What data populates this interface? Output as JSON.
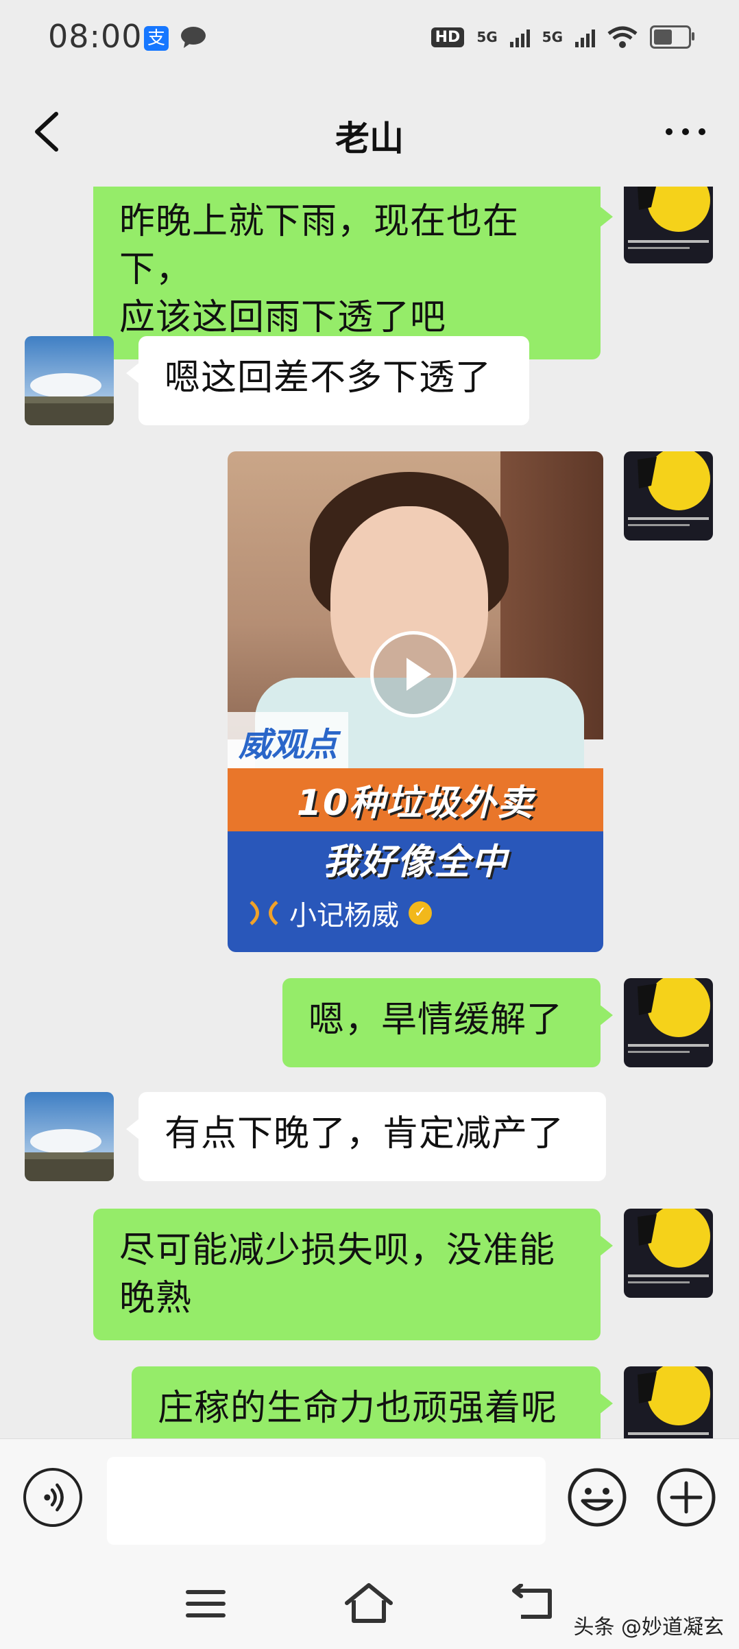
{
  "status_bar": {
    "time": "08:00",
    "alipay_glyph": "支",
    "network_1": "5G",
    "network_2": "5G",
    "hd_badge": "HD"
  },
  "header": {
    "title": "老山"
  },
  "messages": [
    {
      "sender": "me",
      "text_line1": "昨晚上就下雨，现在也在下，",
      "text_line2": "应该这回雨下透了吧"
    },
    {
      "sender": "them",
      "text": "嗯这回差不多下透了"
    },
    {
      "sender": "me",
      "type": "video",
      "tag": "威观点",
      "caption_line1": "10种垃圾外卖",
      "caption_line2": "我好像全中",
      "author": "小记杨威"
    },
    {
      "sender": "me",
      "text": "嗯，旱情缓解了"
    },
    {
      "sender": "them",
      "text": "有点下晚了，肯定减产了"
    },
    {
      "sender": "me",
      "text_line1": "尽可能减少损失呗，没准能",
      "text_line2": "晚熟"
    },
    {
      "sender": "me",
      "text": "庄稼的生命力也顽强着呢"
    }
  ],
  "input": {
    "placeholder": ""
  },
  "watermark": "头条 @妙道凝玄",
  "colors": {
    "background": "#ededed",
    "my_bubble": "#95ec69",
    "their_bubble": "#ffffff"
  },
  "icons": [
    "back-icon",
    "more-icon",
    "voice-icon",
    "emoji-icon",
    "plus-icon",
    "menu-icon",
    "home-icon",
    "back-nav-icon"
  ]
}
